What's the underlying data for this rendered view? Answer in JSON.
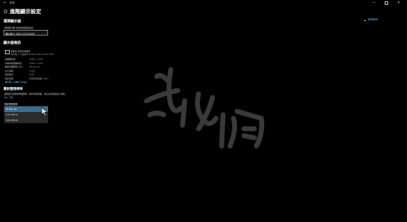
{
  "titlebar": {
    "back_glyph": "←",
    "title": "設定",
    "min_glyph": "—",
    "close_glyph": "✕"
  },
  "page": {
    "title": "進階顯示設定"
  },
  "choose_display": {
    "heading": "選擇顯示器",
    "label": "選取顯示器以檢視或變更其設定",
    "selected": "顯示器 1: DELL S2721DGF"
  },
  "display_info": {
    "heading": "顯示器資訊",
    "monitor_name": "DELL S2721DGF",
    "monitor_sub": "顯示器 1: 已連線到 NVIDIA GeForce RTX 3070",
    "rows": [
      {
        "key": "桌面解析度",
        "value": "2560 × 1440"
      },
      {
        "key": "作用中訊號解析度",
        "value": "2560 × 1440"
      },
      {
        "key": "重新整理頻率 (Hz)",
        "value": "59.951 Hz"
      },
      {
        "key": "位元深度",
        "value": "8 位元"
      },
      {
        "key": "色彩格式",
        "value": "RGB"
      },
      {
        "key": "色彩空間",
        "value": "標準動態範圍 (SDR)"
      }
    ],
    "adapter_link": "顯示器 1 的顯示卡內容"
  },
  "refresh_rate": {
    "heading": "重新整理頻率",
    "desc_line1": "選取較高的重新整理頻率，動作會更流暢，但這也會增加電力消耗。",
    "desc_line2": "深入了解",
    "dropdown_label": "重新整理頻率",
    "options": [
      {
        "label": "59.951 Hz",
        "selected": true
      },
      {
        "label": "119.998 Hz",
        "selected": false
      },
      {
        "label": "144.006 Hz",
        "selected": false
      }
    ]
  },
  "help": {
    "link": "取得說明"
  }
}
